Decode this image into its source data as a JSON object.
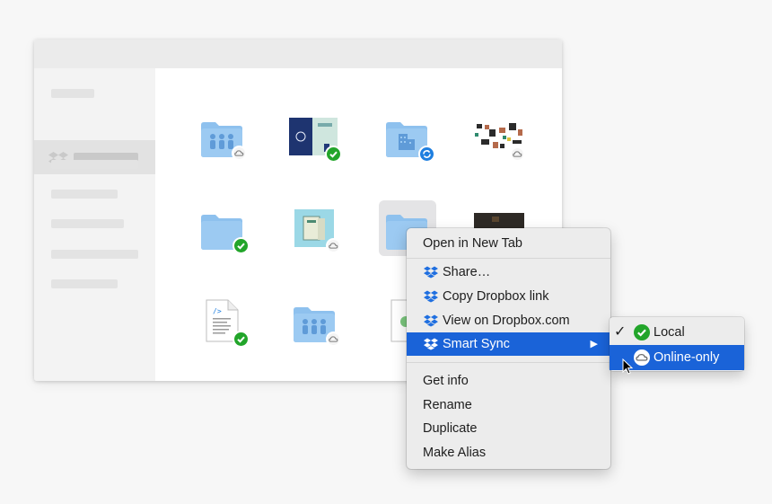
{
  "context_menu": {
    "open_new_tab": "Open in New Tab",
    "share": "Share…",
    "copy_link": "Copy Dropbox link",
    "view_on_web": "View on Dropbox.com",
    "smart_sync": "Smart Sync",
    "smart_sync_arrow": "▶",
    "get_info": "Get info",
    "rename": "Rename",
    "duplicate": "Duplicate",
    "make_alias": "Make Alias"
  },
  "smart_sync_submenu": {
    "checkmark": "✓",
    "local": "Local",
    "online_only": "Online-only",
    "selected": "Local",
    "highlighted": "Online-only"
  },
  "tiles": [
    {
      "kind": "shared-folder",
      "status": "online-only"
    },
    {
      "kind": "image",
      "status": "local"
    },
    {
      "kind": "building-folder",
      "status": "syncing"
    },
    {
      "kind": "image",
      "status": "online-only"
    },
    {
      "kind": "folder",
      "status": "local"
    },
    {
      "kind": "image",
      "status": "online-only"
    },
    {
      "kind": "folder",
      "status": "selected"
    },
    {
      "kind": "image",
      "status": "unknown"
    },
    {
      "kind": "code-file",
      "status": "local"
    },
    {
      "kind": "shared-folder",
      "status": "online-only"
    },
    {
      "kind": "document",
      "status": "unknown"
    }
  ],
  "colors": {
    "folder": "#8ec1ee",
    "folder_dark": "#6aa8e3",
    "local_green": "#22a52a",
    "sync_blue": "#1e7fe0",
    "highlight": "#1a63d8",
    "dropbox_blue": "#1f6fe0"
  }
}
